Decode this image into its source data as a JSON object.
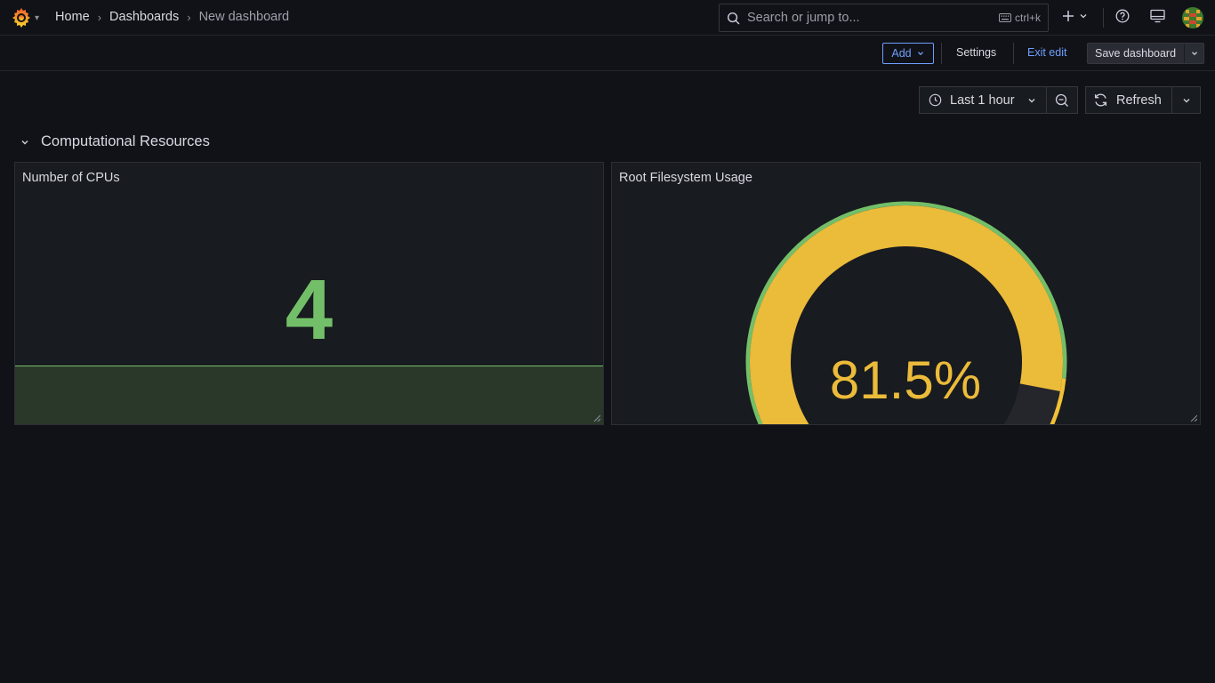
{
  "topbar": {
    "breadcrumb": [
      {
        "label": "Home"
      },
      {
        "label": "Dashboards"
      },
      {
        "label": "New dashboard"
      }
    ],
    "search": {
      "placeholder": "Search or jump to...",
      "shortcut": "ctrl+k"
    }
  },
  "toolbar": {
    "add_label": "Add",
    "settings_label": "Settings",
    "exit_edit_label": "Exit edit",
    "save_label": "Save dashboard"
  },
  "controls": {
    "time_range": "Last 1 hour",
    "refresh_label": "Refresh"
  },
  "row": {
    "title": "Computational Resources"
  },
  "panels": [
    {
      "title": "Number of CPUs",
      "type": "stat",
      "value": "4",
      "color": "#73bf69"
    },
    {
      "title": "Root Filesystem Usage",
      "type": "gauge",
      "value_text": "81.5%",
      "value": 81.5,
      "unit": "%",
      "min": 0,
      "max": 100,
      "thresholds": [
        {
          "from": 0,
          "color": "#73bf69"
        },
        {
          "from": 80,
          "color": "#f2c037"
        },
        {
          "from": 90,
          "color": "#f2495c"
        }
      ],
      "value_color": "#ebbb3a"
    }
  ],
  "colors": {
    "accent": "#6e9fff",
    "green": "#73bf69",
    "yellow": "#ebbb3a",
    "red": "#f2495c"
  },
  "icons": [
    "grafana-logo-icon",
    "search-icon",
    "keyboard-icon",
    "plus-icon",
    "help-icon",
    "monitor-icon",
    "clock-icon",
    "zoom-out-icon",
    "refresh-icon",
    "chevron-down-icon"
  ]
}
